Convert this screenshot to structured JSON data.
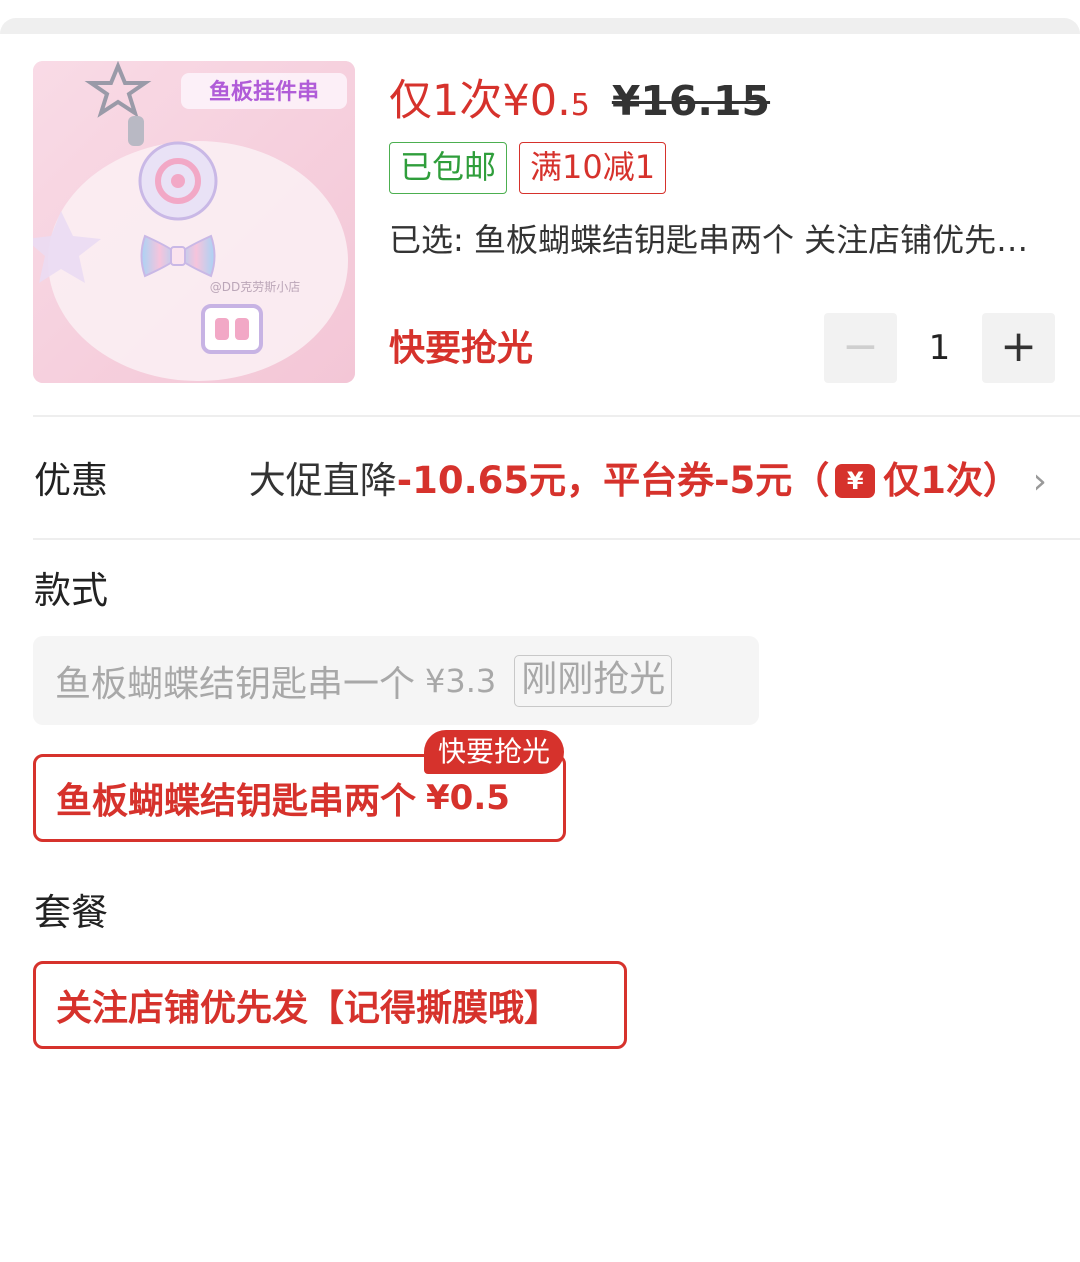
{
  "product": {
    "image_alt": "鱼板挂件串",
    "image_caption": "鱼板挂件串",
    "image_watermark": "@DD克劳斯小店",
    "price_prefix": "仅1次",
    "price_currency": "¥",
    "price_int": "0.",
    "price_dec": "5",
    "original_price": "¥16.15",
    "tags": [
      {
        "label": "已包邮",
        "color": "#2f9e3b"
      },
      {
        "label": "满10减1",
        "color": "#d6322c"
      }
    ],
    "selected_text": "已选: 鱼板蝴蝶结钥匙串两个 关注店铺优先发【记得撕膜哦】",
    "stock_hint": "快要抢光"
  },
  "quantity": {
    "minus_symbol": "−",
    "value": "1",
    "plus_symbol": "+"
  },
  "promo": {
    "label": "优惠",
    "text_prefix": "大促直降",
    "discount": "-10.65元，平台券-5元（",
    "coupon_icon": "¥",
    "once": "仅1次）",
    "chevron": "›"
  },
  "style_section": {
    "title": "款式",
    "options": [
      {
        "name": "鱼板蝴蝶结钥匙串一个",
        "price": "¥3.3",
        "status": "刚刚抢光",
        "selected": false
      },
      {
        "name": "鱼板蝴蝶结钥匙串两个",
        "price": "¥0.5",
        "badge": "快要抢光",
        "selected": true
      }
    ]
  },
  "package_section": {
    "title": "套餐",
    "options": [
      {
        "name": "关注店铺优先发【记得撕膜哦】",
        "selected": true
      }
    ]
  },
  "colors": {
    "accent": "#d6322c",
    "green": "#2f9e3b",
    "muted": "#a8a8a8"
  }
}
